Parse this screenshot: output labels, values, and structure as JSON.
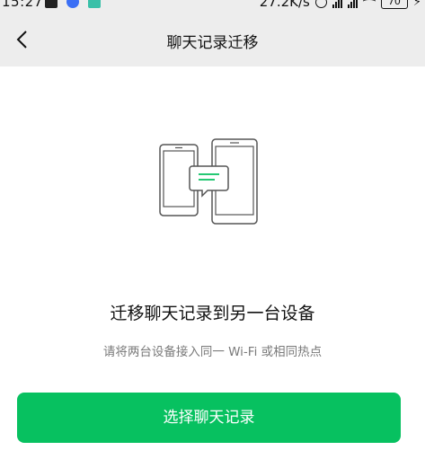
{
  "status_bar": {
    "time": "15:27",
    "speed": "27.2K/s",
    "battery": "70"
  },
  "nav": {
    "back_icon": "chevron-left-icon",
    "title": "聊天记录迁移"
  },
  "illustration": {
    "icon": "phone-to-tablet-chat-transfer-icon",
    "accent_color": "#07c160"
  },
  "content": {
    "heading": "迁移聊天记录到另一台设备",
    "subtext": "请将两台设备接入同一 Wi-Fi 或相同热点"
  },
  "actions": {
    "primary_label": "选择聊天记录",
    "primary_color": "#07c160"
  }
}
